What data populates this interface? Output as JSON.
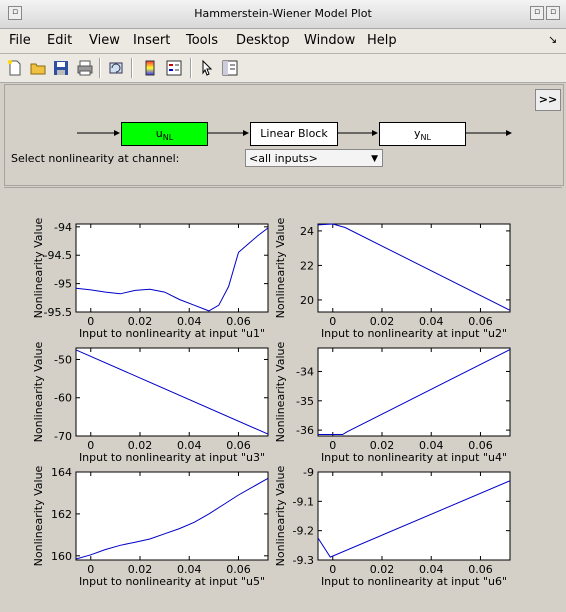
{
  "window": {
    "title": "Hammerstein-Wiener Model Plot"
  },
  "menu": [
    "File",
    "Edit",
    "View",
    "Insert",
    "Tools",
    "Desktop",
    "Window",
    "Help"
  ],
  "toolbar_icons": [
    "new-icon",
    "open-icon",
    "save-icon",
    "print-icon",
    "rotate-icon",
    "colorbar-icon",
    "legend-icon",
    "pointer-icon",
    "plottools-icon"
  ],
  "diagram": {
    "more_label": ">>",
    "input_block": {
      "main": "u",
      "sub": "NL"
    },
    "linear_block": "Linear Block",
    "output_block": {
      "main": "y",
      "sub": "NL"
    },
    "select_label": "Select nonlinearity at channel:",
    "select_value": "<all inputs>"
  },
  "colors": {
    "selected_block": "#00ff00",
    "curve": "#0000c8"
  },
  "chart_data": [
    {
      "type": "line",
      "ylabel": "Nonlinearity Value",
      "xlabel": "Input to nonlinearity at input \"u1\"",
      "xlim": [
        -0.006,
        0.072
      ],
      "ylim": [
        -95.5,
        -93.95
      ],
      "xticks": [
        "0",
        "0.02",
        "0.04",
        "0.06"
      ],
      "yticks": [
        "-94",
        "-94.5",
        "-95",
        "-95.5"
      ],
      "x": [
        -0.006,
        0.0,
        0.006,
        0.012,
        0.018,
        0.024,
        0.03,
        0.036,
        0.042,
        0.048,
        0.052,
        0.056,
        0.06,
        0.064,
        0.068,
        0.072
      ],
      "y": [
        -95.08,
        -95.11,
        -95.15,
        -95.18,
        -95.12,
        -95.1,
        -95.15,
        -95.28,
        -95.38,
        -95.48,
        -95.38,
        -95.05,
        -94.45,
        -94.3,
        -94.15,
        -94.02
      ]
    },
    {
      "type": "line",
      "ylabel": "Nonlinearity Value",
      "xlabel": "Input to nonlinearity at input \"u2\"",
      "xlim": [
        -0.006,
        0.072
      ],
      "ylim": [
        19.3,
        24.4
      ],
      "xticks": [
        "0",
        "0.02",
        "0.04",
        "0.06"
      ],
      "yticks": [
        "24",
        "22",
        "20"
      ],
      "x": [
        -0.006,
        0.0,
        0.005,
        0.072
      ],
      "y": [
        24.35,
        24.4,
        24.2,
        19.4
      ]
    },
    {
      "type": "line",
      "ylabel": "Nonlinearity Value",
      "xlabel": "Input to nonlinearity at input \"u3\"",
      "xlim": [
        -0.006,
        0.072
      ],
      "ylim": [
        -70,
        -47
      ],
      "xticks": [
        "0",
        "0.02",
        "0.04",
        "0.06"
      ],
      "yticks": [
        "-50",
        "-60",
        "-70"
      ],
      "x": [
        -0.006,
        0.072
      ],
      "y": [
        -47.5,
        -69.5
      ]
    },
    {
      "type": "line",
      "ylabel": "Nonlinearity Value",
      "xlabel": "Input to nonlinearity at input \"u4\"",
      "xlim": [
        -0.006,
        0.072
      ],
      "ylim": [
        -36.2,
        -33.2
      ],
      "xticks": [
        "0",
        "0.02",
        "0.04",
        "0.06"
      ],
      "yticks": [
        "-34",
        "-35",
        "-36"
      ],
      "x": [
        -0.006,
        0.004,
        0.006,
        0.072
      ],
      "y": [
        -36.15,
        -36.15,
        -36.05,
        -33.25
      ]
    },
    {
      "type": "line",
      "ylabel": "Nonlinearity Value",
      "xlabel": "Input to nonlinearity at input \"u5\"",
      "xlim": [
        -0.006,
        0.072
      ],
      "ylim": [
        159.8,
        164.0
      ],
      "xticks": [
        "0",
        "0.02",
        "0.04",
        "0.06"
      ],
      "yticks": [
        "164",
        "162",
        "160"
      ],
      "x": [
        -0.006,
        0.0,
        0.006,
        0.012,
        0.018,
        0.024,
        0.03,
        0.036,
        0.042,
        0.048,
        0.054,
        0.06,
        0.066,
        0.072
      ],
      "y": [
        159.85,
        160.05,
        160.3,
        160.5,
        160.65,
        160.8,
        161.05,
        161.3,
        161.6,
        162.0,
        162.45,
        162.9,
        163.3,
        163.7
      ]
    },
    {
      "type": "line",
      "ylabel": "Nonlinearity Value",
      "xlabel": "Input to nonlinearity at input \"u6\"",
      "xlim": [
        -0.006,
        0.072
      ],
      "ylim": [
        -9.3,
        -9.0
      ],
      "xticks": [
        "0",
        "0.02",
        "0.04",
        "0.06"
      ],
      "yticks": [
        "-9",
        "-9.1",
        "-9.2",
        "-9.3"
      ],
      "x": [
        -0.006,
        -0.001,
        0.072
      ],
      "y": [
        -9.225,
        -9.29,
        -9.03
      ]
    }
  ]
}
